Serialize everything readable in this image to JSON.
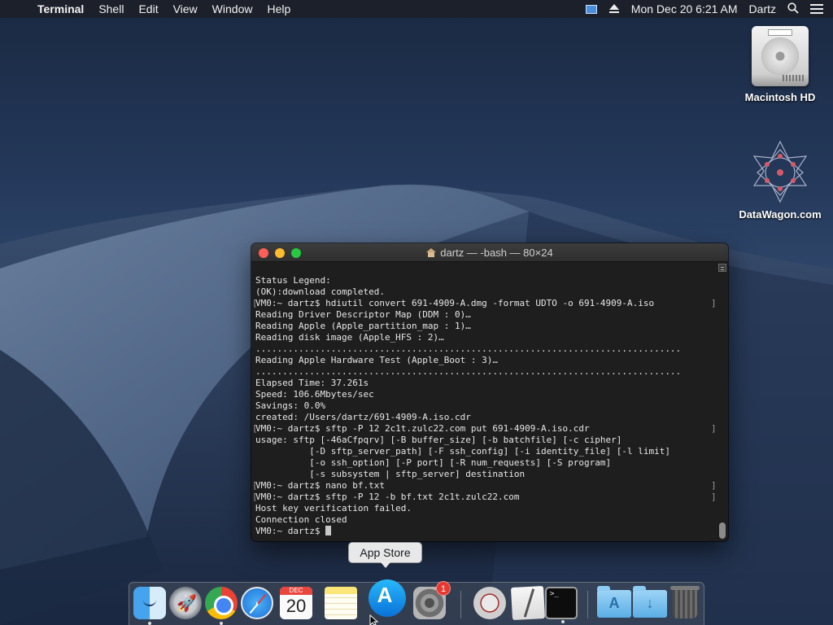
{
  "menubar": {
    "app_name": "Terminal",
    "menus": [
      "Shell",
      "Edit",
      "View",
      "Window",
      "Help"
    ],
    "clock": "Mon Dec 20  6:21 AM",
    "user": "Dartz"
  },
  "desktop": {
    "icons": [
      {
        "label": "Macintosh HD",
        "icon": "hard-drive-icon"
      },
      {
        "label": "DataWagon.com",
        "icon": "datawagon-logo-icon"
      }
    ]
  },
  "terminal": {
    "title": "dartz — -bash — 80×24",
    "lines": [
      {
        "text": "Status Legend:",
        "mark": false
      },
      {
        "text": "(OK):download completed.",
        "mark": false
      },
      {
        "text": "VM0:~ dartz$ hdiutil convert 691-4909-A.dmg -format UDTO -o 691-4909-A.iso",
        "mark": true
      },
      {
        "text": "Reading Driver Descriptor Map (DDM : 0)…",
        "mark": false
      },
      {
        "text": "Reading Apple (Apple_partition_map : 1)…",
        "mark": false
      },
      {
        "text": "Reading disk image (Apple_HFS : 2)…",
        "mark": false
      },
      {
        "text": "...............................................................................",
        "mark": false
      },
      {
        "text": "Reading Apple Hardware Test (Apple_Boot : 3)…",
        "mark": false
      },
      {
        "text": "...............................................................................",
        "mark": false
      },
      {
        "text": "Elapsed Time: 37.261s",
        "mark": false
      },
      {
        "text": "Speed: 106.6Mbytes/sec",
        "mark": false
      },
      {
        "text": "Savings: 0.0%",
        "mark": false
      },
      {
        "text": "created: /Users/dartz/691-4909-A.iso.cdr",
        "mark": false
      },
      {
        "text": "VM0:~ dartz$ sftp -P 12 2c1t.zulc22.com put 691-4909-A.iso.cdr",
        "mark": true
      },
      {
        "text": "usage: sftp [-46aCfpqrv] [-B buffer_size] [-b batchfile] [-c cipher]",
        "mark": false
      },
      {
        "text": "          [-D sftp_server_path] [-F ssh_config] [-i identity_file] [-l limit]",
        "mark": false
      },
      {
        "text": "          [-o ssh_option] [-P port] [-R num_requests] [-S program]",
        "mark": false
      },
      {
        "text": "          [-s subsystem | sftp_server] destination",
        "mark": false
      },
      {
        "text": "VM0:~ dartz$ nano bf.txt",
        "mark": true
      },
      {
        "text": "VM0:~ dartz$ sftp -P 12 -b bf.txt 2c1t.zulc22.com",
        "mark": true
      },
      {
        "text": "Host key verification failed.",
        "mark": false
      },
      {
        "text": "Connection closed",
        "mark": false
      }
    ],
    "prompt": "VM0:~ dartz$ "
  },
  "dock": {
    "tooltip": "App Store",
    "calendar_month": "DEC",
    "calendar_day": "20",
    "sysprefs_badge": "1",
    "items": [
      "finder-icon",
      "launchpad-icon",
      "chrome-icon",
      "safari-icon",
      "calendar-icon",
      "notes-icon",
      "app-store-icon",
      "system-preferences-icon",
      "photo-booth-icon",
      "textedit-icon",
      "terminal-icon",
      "applications-folder-icon",
      "downloads-folder-icon",
      "trash-icon"
    ]
  }
}
